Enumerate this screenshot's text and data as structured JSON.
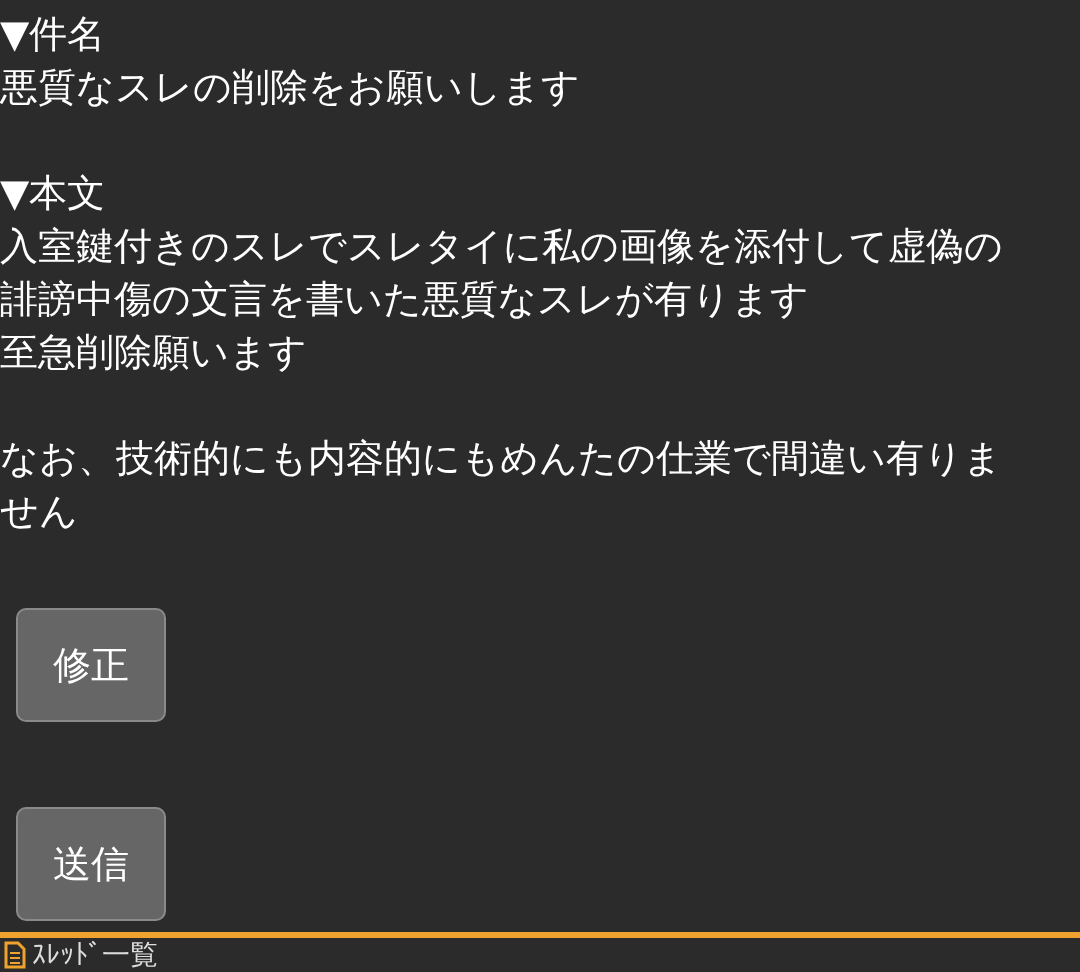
{
  "sections": [
    {
      "heading": "▼件名",
      "paragraphs": [
        [
          "悪質なスレの削除をお願いします"
        ]
      ]
    },
    {
      "heading": "▼本文",
      "paragraphs": [
        [
          "入室鍵付きのスレでスレタイに私の画像を添付して虚偽の",
          "誹謗中傷の文言を書いた悪質なスレが有ります",
          "至急削除願います"
        ],
        [
          "なお、技術的にも内容的にもめんたの仕業で間違い有りま",
          "せん"
        ]
      ]
    }
  ],
  "buttons": [
    "修正",
    "送信"
  ],
  "footer": {
    "title": "ｽﾚｯﾄﾞ一覧"
  }
}
